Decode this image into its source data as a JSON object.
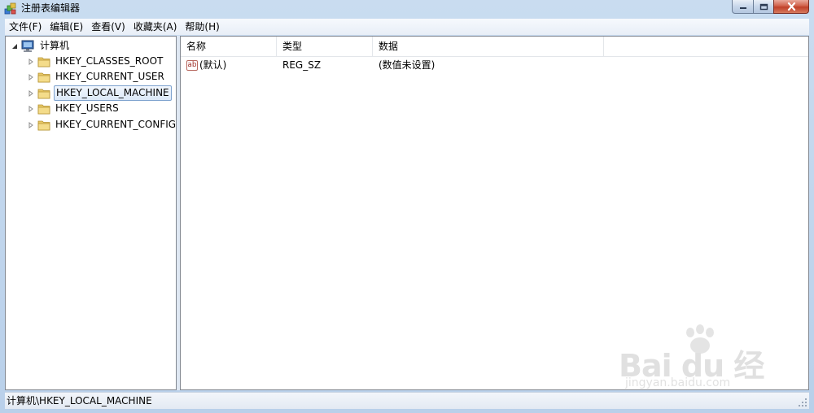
{
  "window": {
    "title": "注册表编辑器",
    "icon": "registry-editor-icon"
  },
  "caption_buttons": {
    "minimize": "minimize-icon",
    "maximize": "maximize-icon",
    "close": "close-icon"
  },
  "menu": [
    {
      "label": "文件(F)"
    },
    {
      "label": "编辑(E)"
    },
    {
      "label": "查看(V)"
    },
    {
      "label": "收藏夹(A)"
    },
    {
      "label": "帮助(H)"
    }
  ],
  "tree": {
    "root": {
      "label": "计算机",
      "icon": "computer-icon",
      "expanded": true
    },
    "keys": [
      {
        "label": "HKEY_CLASSES_ROOT",
        "icon": "folder-icon",
        "selected": false
      },
      {
        "label": "HKEY_CURRENT_USER",
        "icon": "folder-icon",
        "selected": false
      },
      {
        "label": "HKEY_LOCAL_MACHINE",
        "icon": "folder-icon",
        "selected": true
      },
      {
        "label": "HKEY_USERS",
        "icon": "folder-icon",
        "selected": false
      },
      {
        "label": "HKEY_CURRENT_CONFIG",
        "icon": "folder-icon",
        "selected": false
      }
    ]
  },
  "list": {
    "columns": [
      "名称",
      "类型",
      "数据"
    ],
    "rows": [
      {
        "name": "(默认)",
        "type": "REG_SZ",
        "data": "(数值未设置)",
        "icon": "string-value-icon",
        "icon_text": "ab"
      }
    ]
  },
  "status": {
    "path": "计算机\\HKEY_LOCAL_MACHINE"
  },
  "watermark": {
    "main": "Bai du 经验",
    "sub": "jingyan.baidu.com"
  },
  "colors": {
    "selection_border": "#7da2ce",
    "close_button": "#c0412a",
    "folder": "#e8c867"
  }
}
